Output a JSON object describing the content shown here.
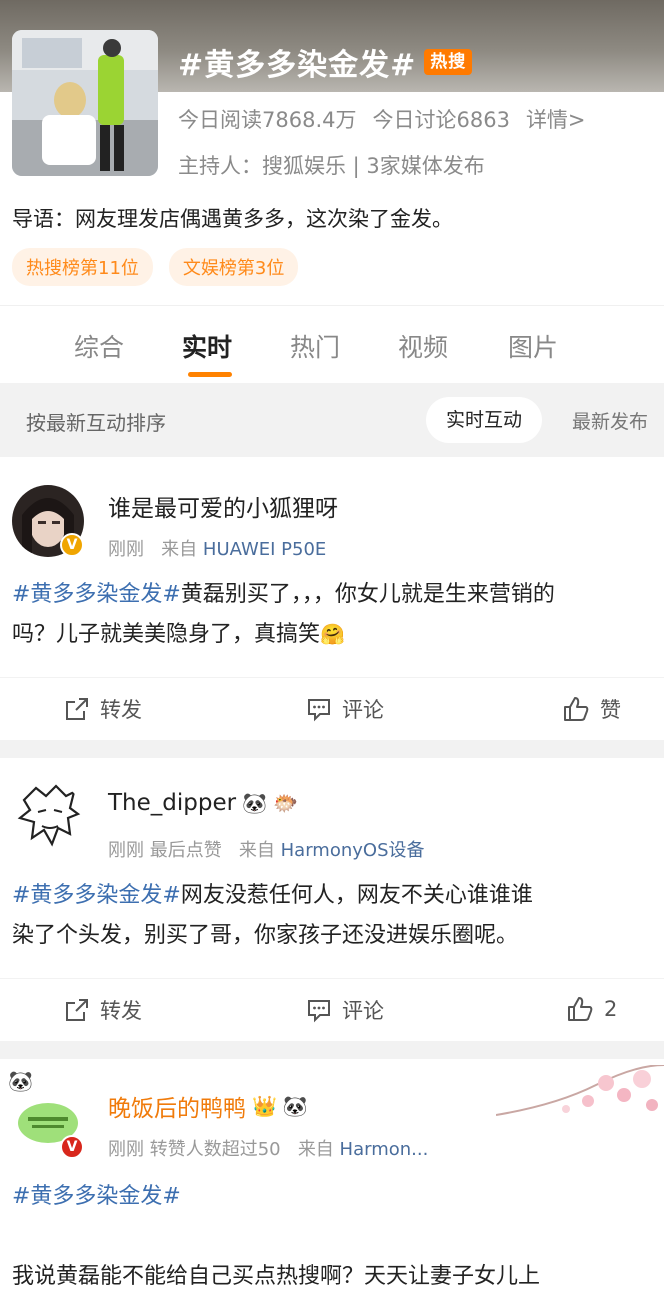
{
  "topic": {
    "title": "#黄多多染金发#",
    "badge": "热搜",
    "reads": "今日阅读7868.4万",
    "discussions": "今日讨论6863",
    "details_link": "详情>",
    "host": "主持人：搜狐娱乐 | 3家媒体发布",
    "intro": "导语：网友理发店偶遇黄多多，这次染了金发。",
    "ranks": [
      "热搜榜第11位",
      "文娱榜第3位"
    ]
  },
  "tabs": [
    "综合",
    "实时",
    "热门",
    "视频",
    "图片"
  ],
  "active_tab": "实时",
  "sort": {
    "label": "按最新互动排序",
    "active_option": "实时互动",
    "other_option": "最新发布"
  },
  "posts": [
    {
      "username": "谁是最可爱的小狐狸呀",
      "meta_time": "刚刚",
      "meta_from": "来自",
      "meta_source": "HUAWEI P50E",
      "hashtag": "#黄多多染金发#",
      "text_line1": "黄磊别买了，，，你女儿就是生来营销的",
      "text_line2": "吗？儿子就美美隐身了，真搞笑",
      "repost_label": "转发",
      "comment_label": "评论",
      "like_label": "赞"
    },
    {
      "username": "The_dipper",
      "meta_time": "刚刚",
      "meta_extra": "最后点赞",
      "meta_from": "来自",
      "meta_source": "HarmonyOS设备",
      "hashtag": "#黄多多染金发#",
      "text_line1": "网友没惹任何人，网友不关心谁谁谁",
      "text_line2": "染了个头发，别买了哥，你家孩子还没进娱乐圈呢。",
      "repost_label": "转发",
      "comment_label": "评论",
      "like_label": "2"
    },
    {
      "username": "晚饭后的鸭鸭",
      "meta_time": "刚刚",
      "meta_extra": "转赞人数超过50",
      "meta_from": "来自",
      "meta_source": "Harmon...",
      "hashtag": "#黄多多染金发#",
      "text_line2": "我说黄磊能不能给自己买点热搜啊？天天让妻子女儿上"
    }
  ],
  "icons": [
    "repost-icon",
    "comment-icon",
    "like-icon",
    "verified-badge-icon",
    "panda-emoji-icon",
    "pufferfish-emoji-icon",
    "crown-emoji-icon",
    "hug-emoji-icon"
  ],
  "colors": {
    "accent": "#ff8200",
    "hashtag": "#3d6fb0",
    "source": "#4a6d9c",
    "hot_badge": "#ff7a00"
  }
}
